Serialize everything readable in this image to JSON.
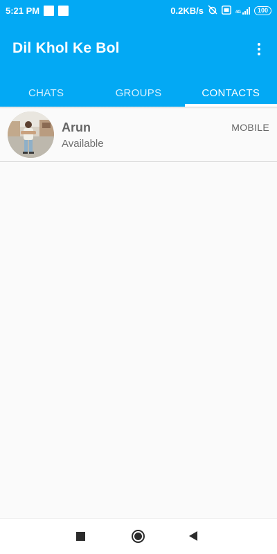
{
  "status_bar": {
    "time": "5:21 PM",
    "network_speed": "0.2KB/s",
    "network_type": "4G",
    "battery": "100",
    "icons": [
      "notification-square-icon",
      "notification-square-icon",
      "alarm-off-icon",
      "volte-icon",
      "signal-icon",
      "battery-icon"
    ]
  },
  "app_bar": {
    "title": "Dil Khol Ke Bol",
    "menu_icon": "more-vert-icon"
  },
  "tabs": [
    {
      "label": "CHATS",
      "active": false
    },
    {
      "label": "GROUPS",
      "active": false
    },
    {
      "label": "CONTACTS",
      "active": true
    }
  ],
  "contacts": [
    {
      "name": "Arun",
      "status": "Available",
      "type": "MOBILE",
      "avatar": "person-photo"
    }
  ],
  "nav_bar": {
    "icons": [
      "recents-square-icon",
      "home-circle-icon",
      "back-triangle-icon"
    ]
  },
  "colors": {
    "primary": "#03a9f4",
    "on_primary": "#ffffff",
    "background": "#fafafa",
    "text_secondary": "#666666"
  }
}
